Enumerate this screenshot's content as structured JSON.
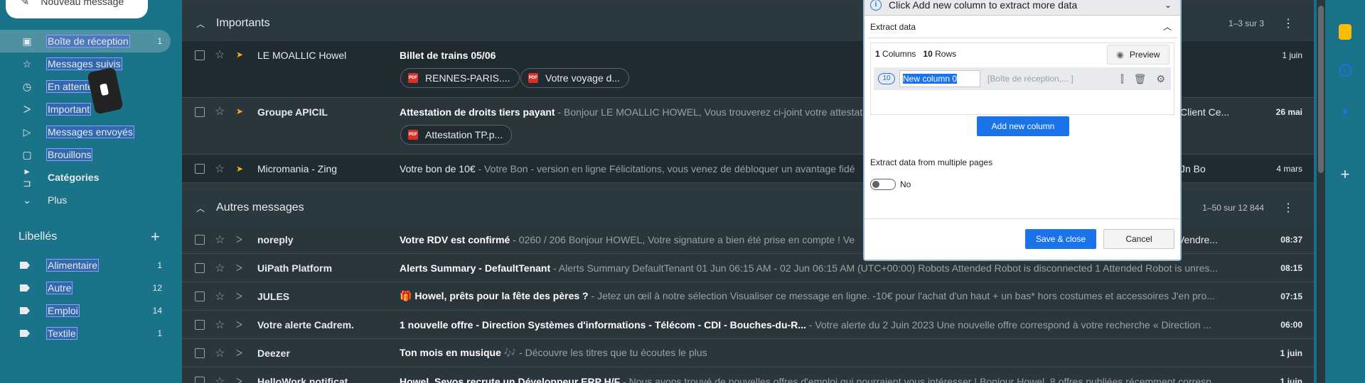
{
  "compose_label": "Nouveau message",
  "nav": [
    {
      "label": "Boîte de réception",
      "count": "1",
      "icon": "inbox-icon"
    },
    {
      "label": "Messages suivis",
      "count": "",
      "icon": "star-icon"
    },
    {
      "label": "En attente",
      "count": "",
      "icon": "clock-icon"
    },
    {
      "label": "Important",
      "count": "",
      "icon": "important-icon"
    },
    {
      "label": "Messages envoyés",
      "count": "",
      "icon": "send-icon"
    },
    {
      "label": "Brouillons",
      "count": "",
      "icon": "draft-icon"
    },
    {
      "label": "Catégories",
      "count": "",
      "icon": "label-icon"
    },
    {
      "label": "Plus",
      "count": "",
      "icon": "chevron-down-icon"
    }
  ],
  "labels_title": "Libellés",
  "labels": [
    {
      "label": "Alimentaire",
      "count": "1"
    },
    {
      "label": "Autre",
      "count": "12"
    },
    {
      "label": "Emploi",
      "count": "14"
    },
    {
      "label": "Textile",
      "count": "1"
    }
  ],
  "important_section": {
    "title": "Importants",
    "range": "1–3 sur 3",
    "rows": [
      {
        "sender": "LE MOALLIC Howel",
        "subject": "Billet de trains 05/06",
        "snippet": "",
        "date": "1 juin",
        "chips": [
          "RENNES-PARIS....",
          "Votre voyage d..."
        ]
      },
      {
        "sender": "Groupe APICIL",
        "subject": "Attestation de droits tiers payant",
        "snippet": " - Bonjour LE MOALLIC HOWEL, Vous trouverez ci-joint votre attestation",
        "date": "26 mai",
        "chips": [
          "Attestation TP.p..."
        ],
        "tail": "Client Ce..."
      },
      {
        "sender": "Micromania - Zing",
        "subject": "Votre bon de 10€",
        "snippet": " - Votre Bon - version en ligne Félicitations, vous venez de débloquer un avantage fidé",
        "date": "4 mars",
        "chips": [],
        "tail": "Jn Bo"
      }
    ]
  },
  "other_section": {
    "title": "Autres messages",
    "range": "1–50 sur 12 844",
    "rows": [
      {
        "sender": "noreply",
        "subject": "Votre RDV est confirmé",
        "snippet": " - 0260 / 206 Bonjour HOWEL, Votre signature a bien été prise en compte ! Ve",
        "tail": "s Vendre...",
        "date": "08:37"
      },
      {
        "sender": "UiPath Platform",
        "subject": "Alerts Summary - DefaultTenant",
        "snippet": " - Alerts Summary DefaultTenant 01 Jun 06:15 AM - 02 Jun 06:15 AM (UTC+00:00) Robots Attended Robot is disconnected 1 Attended Robot is unres...",
        "date": "08:15"
      },
      {
        "sender": "JULES",
        "subject": "🎁 Howel, prêts pour la fête des pères ?",
        "snippet": " - Jetez un œil à notre sélection Visualiser ce message en ligne. -10€ pour l'achat d'un haut + un bas* hors costumes et accessoires J'en pro...",
        "date": "07:15"
      },
      {
        "sender": "Votre alerte Cadrem.",
        "subject": "1 nouvelle offre - Direction Systèmes d'informations - Télécom - CDI - Bouches-du-R...",
        "snippet": " - Votre alerte du 2 Juin 2023 Une nouvelle offre correspond à votre recherche « Direction ...",
        "date": "06:00"
      },
      {
        "sender": "Deezer",
        "subject": "Ton mois en musique",
        "snippet": " 🎶 - Découvre les titres que tu écoutes le plus",
        "date": "1 juin"
      },
      {
        "sender": "HelloWork notificat.",
        "subject": "Howel, Seyos recrute un Développeur ERP H/F",
        "snippet": " - Nous avons trouvé de nouvelles offres d'emploi qui pourraient vous intéresser ! Bonjour Howel, 8 offres publiées récemment corresp...",
        "date": "1 juin"
      }
    ]
  },
  "dialog": {
    "top_message": "Click Add new column to extract more data",
    "section_title": "Extract data",
    "columns_count": "1",
    "columns_label": "Columns",
    "rows_count": "10",
    "rows_label": "Rows",
    "preview_label": "Preview",
    "column_number": "10",
    "column_name": "New column 0",
    "column_preview": "[Boîte de réception,...   ]",
    "add_column_label": "Add new column",
    "multi_pages_label": "Extract data from multiple pages",
    "toggle_label": "No",
    "save_label": "Save & close",
    "cancel_label": "Cancel"
  }
}
